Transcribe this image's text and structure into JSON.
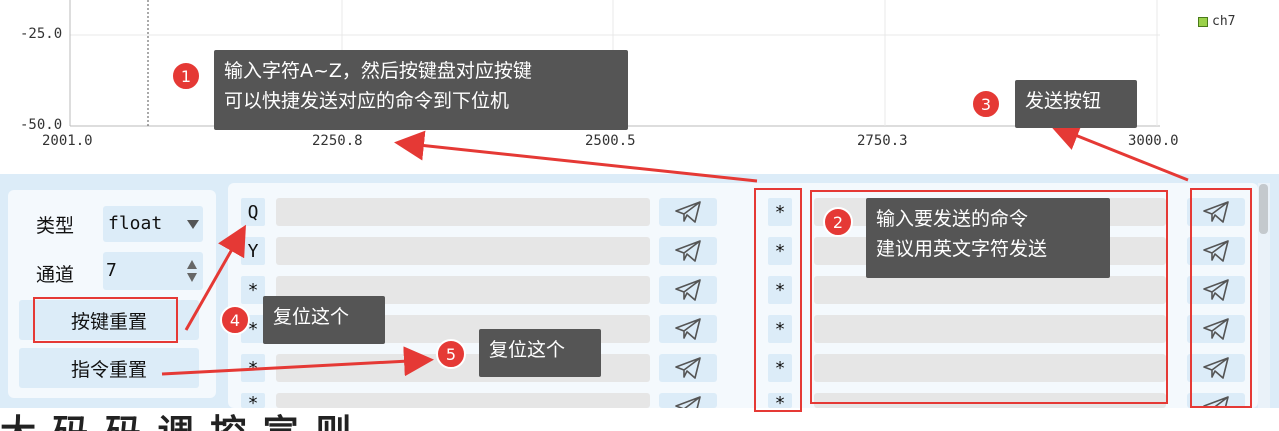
{
  "chart_data": {
    "type": "line",
    "yticks": [
      "-25.0",
      "-50.0"
    ],
    "xticks": [
      "2001.0",
      "2250.8",
      "2500.5",
      "2750.3",
      "3000.0"
    ],
    "xlim": [
      2001.0,
      3000.0
    ],
    "ylim": [
      -50.0,
      0
    ],
    "grid": true,
    "legend": {
      "entries": [
        "ch7"
      ],
      "placement": "right"
    },
    "series": [
      {
        "name": "ch7",
        "values": []
      }
    ]
  },
  "colors": {
    "panel_bg": "#dcecf8",
    "annotation_red": "#e53935",
    "tooltip_bg": "#555555",
    "legend_swatch": "#9bd24a"
  },
  "sidebar": {
    "type_label": "类型",
    "type_value": "float",
    "channel_label": "通道",
    "channel_value": "7",
    "reset_keys_label": "按键重置",
    "reset_commands_label": "指令重置"
  },
  "rows": [
    {
      "key": "Q",
      "shortcut": "*"
    },
    {
      "key": "Y",
      "shortcut": "*"
    },
    {
      "key": "*",
      "shortcut": "*"
    },
    {
      "key": "*",
      "shortcut": "*"
    },
    {
      "key": "*",
      "shortcut": "*"
    },
    {
      "key": "*",
      "shortcut": "*"
    }
  ],
  "icons": {
    "send": "paper-plane-icon",
    "dropdown": "caret-down-icon",
    "spinner": "spinner-arrows-icon"
  },
  "annotations": [
    {
      "number": "1",
      "text_line1": "输入字符A~Z，然后按键盘对应按键",
      "text_line2": "可以快捷发送对应的命令到下位机"
    },
    {
      "number": "2",
      "text_line1": "输入要发送的命令",
      "text_line2": "建议用英文字符发送"
    },
    {
      "number": "3",
      "text_line1": "发送按钮"
    },
    {
      "number": "4",
      "text_line1": "复位这个"
    },
    {
      "number": "5",
      "text_line1": "复位这个"
    }
  ],
  "background_text": "大 码 码 调 控 宣 则"
}
